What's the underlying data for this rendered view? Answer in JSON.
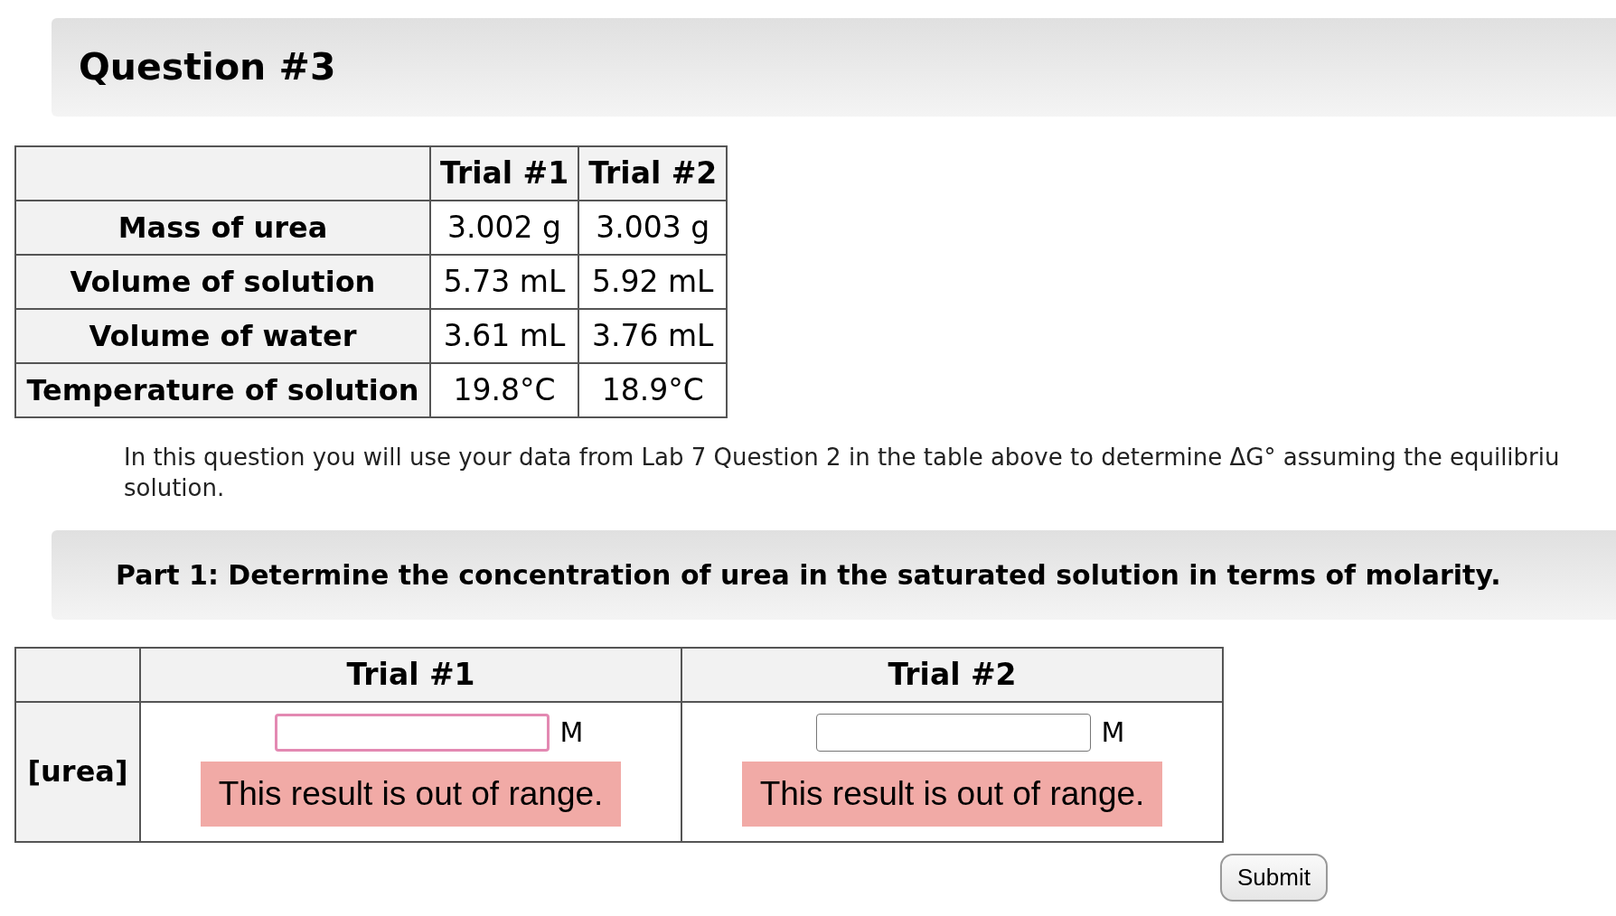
{
  "question_title": "Question #3",
  "data_table": {
    "columns": [
      "Trial #1",
      "Trial #2"
    ],
    "rows": [
      {
        "label": "Mass of urea",
        "values": [
          "3.002 g",
          "3.003 g"
        ]
      },
      {
        "label": "Volume of solution",
        "values": [
          "5.73 mL",
          "5.92 mL"
        ]
      },
      {
        "label": "Volume of water",
        "values": [
          "3.61 mL",
          "3.76 mL"
        ]
      },
      {
        "label": "Temperature of solution",
        "values": [
          "19.8°C",
          "18.9°C"
        ]
      }
    ]
  },
  "instructions": [
    "In this question you will use your data from Lab 7 Question 2 in the table above to determine ΔG° assuming the equilibriu",
    "solution."
  ],
  "part_title": "Part 1: Determine the concentration of urea in the saturated solution in terms of molarity.",
  "answer_table": {
    "columns": [
      "Trial #1",
      "Trial #2"
    ],
    "row_label": "[urea]",
    "cells": [
      {
        "unit": "M",
        "focused": true,
        "error": "This result is out of range."
      },
      {
        "unit": "M",
        "focused": false,
        "error": "This result is out of range."
      }
    ]
  },
  "submit": "Submit"
}
